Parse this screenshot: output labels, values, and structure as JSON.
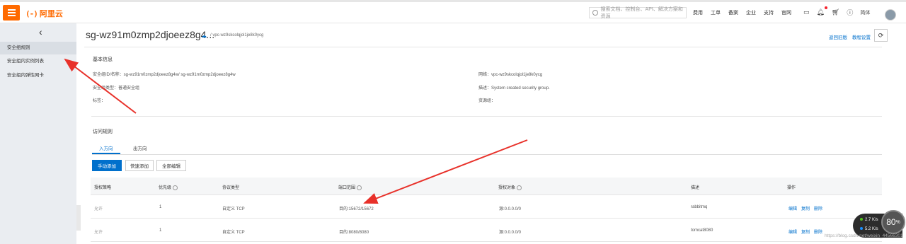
{
  "header": {
    "logo_mark": "(-)",
    "logo_text": "阿里云",
    "search_placeholder": "搜索文档、控制台、API、解决方案和资源",
    "nav": [
      "费用",
      "工单",
      "备案",
      "企业",
      "支持",
      "官网"
    ],
    "lang": "简体",
    "accent_color": "#ff6a00"
  },
  "sidebar": {
    "collapse_icon": "chevron-left-icon",
    "items": [
      {
        "label": "安全组规则",
        "active": true
      },
      {
        "label": "安全组内实例列表",
        "active": false
      },
      {
        "label": "安全组内弹性网卡",
        "active": false
      }
    ]
  },
  "page": {
    "title": "sg-wz91m0zmp2djoeez8g4...",
    "vpc": "/ vpc-wz9skcolqjol1je8k0ycg",
    "links": [
      "返回旧版",
      "教程设置"
    ]
  },
  "basic_info": {
    "title": "基本信息",
    "id_label": "安全组ID/名称：",
    "id_value": "sg-wz91m0zmp2djoeez8g4w/ sg-wz91m0zmp2djoeez8g4w",
    "network_label": "网络：",
    "network_value": "vpc-wz9skcolqjol1je8k0ycg",
    "type_label": "安全组类型：",
    "type_value": "普通安全组",
    "desc_label": "描述：",
    "desc_value": "System created security group.",
    "tag_label": "标签：",
    "resource_group_label": "资源组："
  },
  "rules": {
    "title": "访问规则",
    "tabs": [
      "入方向",
      "出方向"
    ],
    "buttons": [
      "手动添加",
      "快速添加",
      "全部编辑"
    ],
    "columns": [
      "授权策略",
      "优先级",
      "协议类型",
      "端口范围",
      "授权对象",
      "描述",
      "操作"
    ],
    "rows": [
      {
        "policy": "允许",
        "priority": "1",
        "protocol": "自定义 TCP",
        "port": "目的:15672/15672",
        "source": "源:0.0.0.0/0",
        "desc": "rabbitmq",
        "actions": [
          "编辑",
          "复制",
          "删除"
        ]
      },
      {
        "policy": "允许",
        "priority": "1",
        "protocol": "自定义 TCP",
        "port": "目的:8080/8080",
        "source": "源:0.0.0.0/0",
        "desc": "tomcat8080",
        "actions": [
          "编辑",
          "复制",
          "删除"
        ]
      }
    ]
  },
  "overlay": {
    "speed_up": "2.7",
    "speed_up_unit": "K/s",
    "speed_down": "5.2",
    "speed_down_unit": "K/s",
    "gauge": "80",
    "gauge_unit": "%",
    "watermark": "https://blog.csdn.net/weixin_44566301",
    "arrow_color": "#e8312a"
  }
}
